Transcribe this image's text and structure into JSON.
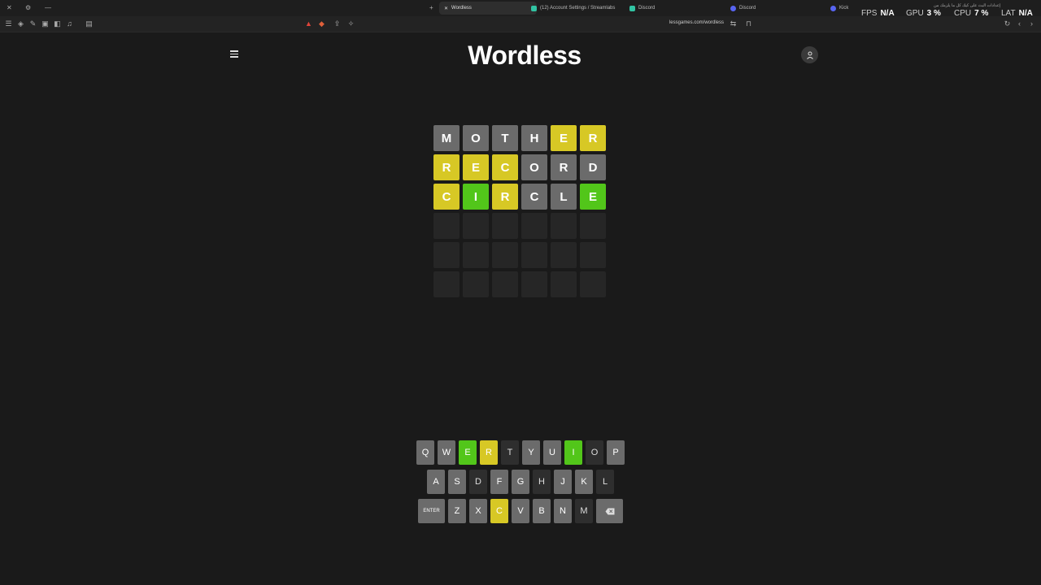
{
  "browser": {
    "tabs": [
      {
        "label": "Wordless",
        "active": true,
        "icon_color": "#e0e0e0"
      },
      {
        "label": "(12) Account Settings / Streamlabs",
        "active": false,
        "icon_color": "#31c3a2"
      },
      {
        "label": "Discord",
        "active": false,
        "icon_color": "#5865f2"
      },
      {
        "label": "Discord",
        "active": false,
        "icon_color": "#5865f2"
      },
      {
        "label": "Kick",
        "active": false,
        "icon_color": "#5865f2"
      }
    ],
    "url": "lessgames.com/wordless",
    "hud": {
      "fps_label": "FPS",
      "fps_value": "N/A",
      "gpu_label": "GPU",
      "gpu_value": "3 %",
      "cpu_label": "CPU",
      "cpu_value": "7 %",
      "lat_label": "LAT",
      "lat_value": "N/A",
      "note": "إعدادات البث على كيك كل ما يلزمك من"
    }
  },
  "header": {
    "logo": "Wordless",
    "menu_icon": "hamburger-icon",
    "profile_icon": "user-icon"
  },
  "board": {
    "rows": [
      [
        {
          "l": "M",
          "s": "absent"
        },
        {
          "l": "O",
          "s": "absent"
        },
        {
          "l": "T",
          "s": "absent"
        },
        {
          "l": "H",
          "s": "absent"
        },
        {
          "l": "E",
          "s": "present"
        },
        {
          "l": "R",
          "s": "present"
        }
      ],
      [
        {
          "l": "R",
          "s": "present"
        },
        {
          "l": "E",
          "s": "present"
        },
        {
          "l": "C",
          "s": "present"
        },
        {
          "l": "O",
          "s": "absent"
        },
        {
          "l": "R",
          "s": "absent"
        },
        {
          "l": "D",
          "s": "absent"
        }
      ],
      [
        {
          "l": "C",
          "s": "present"
        },
        {
          "l": "I",
          "s": "correct"
        },
        {
          "l": "R",
          "s": "present"
        },
        {
          "l": "C",
          "s": "absent"
        },
        {
          "l": "L",
          "s": "absent"
        },
        {
          "l": "E",
          "s": "correct"
        }
      ],
      [
        {
          "l": "",
          "s": "empty"
        },
        {
          "l": "",
          "s": "empty"
        },
        {
          "l": "",
          "s": "empty"
        },
        {
          "l": "",
          "s": "empty"
        },
        {
          "l": "",
          "s": "empty"
        },
        {
          "l": "",
          "s": "empty"
        }
      ],
      [
        {
          "l": "",
          "s": "empty"
        },
        {
          "l": "",
          "s": "empty"
        },
        {
          "l": "",
          "s": "empty"
        },
        {
          "l": "",
          "s": "empty"
        },
        {
          "l": "",
          "s": "empty"
        },
        {
          "l": "",
          "s": "empty"
        }
      ],
      [
        {
          "l": "",
          "s": "empty"
        },
        {
          "l": "",
          "s": "empty"
        },
        {
          "l": "",
          "s": "empty"
        },
        {
          "l": "",
          "s": "empty"
        },
        {
          "l": "",
          "s": "empty"
        },
        {
          "l": "",
          "s": "empty"
        }
      ]
    ]
  },
  "keyboard": {
    "rows": [
      [
        {
          "k": "Q",
          "s": "unused"
        },
        {
          "k": "W",
          "s": "unused"
        },
        {
          "k": "E",
          "s": "correct"
        },
        {
          "k": "R",
          "s": "present"
        },
        {
          "k": "T",
          "s": "absent"
        },
        {
          "k": "Y",
          "s": "unused"
        },
        {
          "k": "U",
          "s": "unused"
        },
        {
          "k": "I",
          "s": "correct"
        },
        {
          "k": "O",
          "s": "absent"
        },
        {
          "k": "P",
          "s": "unused"
        }
      ],
      [
        {
          "k": "A",
          "s": "unused"
        },
        {
          "k": "S",
          "s": "unused"
        },
        {
          "k": "D",
          "s": "absent"
        },
        {
          "k": "F",
          "s": "unused"
        },
        {
          "k": "G",
          "s": "unused"
        },
        {
          "k": "H",
          "s": "absent"
        },
        {
          "k": "J",
          "s": "unused"
        },
        {
          "k": "K",
          "s": "unused"
        },
        {
          "k": "L",
          "s": "absent"
        }
      ],
      [
        {
          "k": "ENTER",
          "s": "unused",
          "wide": true
        },
        {
          "k": "Z",
          "s": "unused"
        },
        {
          "k": "X",
          "s": "unused"
        },
        {
          "k": "C",
          "s": "present"
        },
        {
          "k": "V",
          "s": "unused"
        },
        {
          "k": "B",
          "s": "unused"
        },
        {
          "k": "N",
          "s": "unused"
        },
        {
          "k": "M",
          "s": "absent"
        },
        {
          "k": "",
          "s": "unused",
          "wide": true,
          "icon": "backspace-icon"
        }
      ]
    ]
  },
  "colors": {
    "background": "#1a1a1a",
    "absent": "#6b6b6b",
    "present": "#d7c825",
    "correct": "#52c61a",
    "empty": "#262626"
  }
}
